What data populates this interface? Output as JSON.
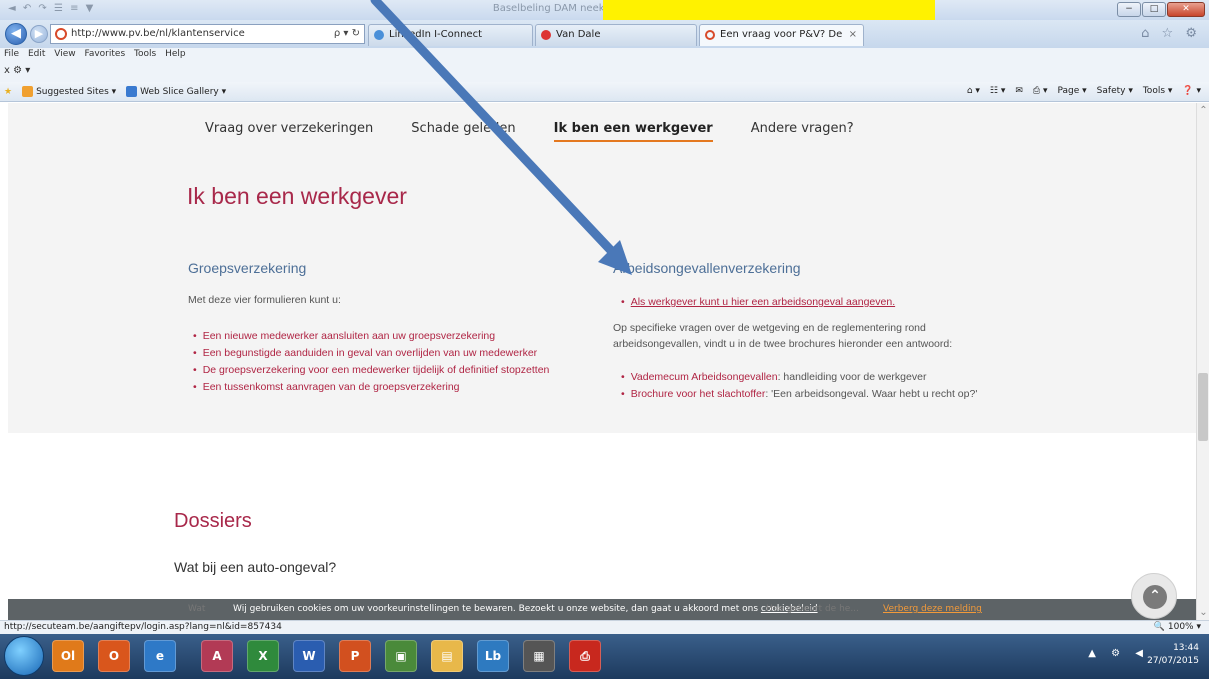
{
  "window": {
    "title": "Baselbeling DAM neek doco - Microsoft Word",
    "quick_access": "◄ ↶ ↷ ☰ ≡ ▼",
    "controls": {
      "minimize": "−",
      "maximize": "□",
      "close": "✕"
    }
  },
  "address": {
    "url": "http://www.pv.be/nl/klantenservice",
    "tools": "ρ ▾ ↻"
  },
  "tabs": [
    {
      "label": "LinkedIn I-Connect",
      "color": "#4a90d9"
    },
    {
      "label": "Van Dale",
      "color": "#d33"
    },
    {
      "label": "Een vraag voor P&V? De kla...",
      "color": "#d84a2a",
      "active": true
    }
  ],
  "chrome_icons": "⌂ ☆ ⚙",
  "menu": [
    "File",
    "Edit",
    "View",
    "Favorites",
    "Tools",
    "Help"
  ],
  "command_bar": "x  ⚙ ▾",
  "favorites": {
    "items": [
      {
        "label": "Suggested Sites ▾",
        "color": "#f0a030"
      },
      {
        "label": "Web Slice Gallery ▾",
        "color": "#3a7ad0"
      }
    ],
    "right_tools": [
      "⌂ ▾",
      "☷ ▾",
      "✉",
      "⎙ ▾",
      "Page ▾",
      "Safety ▾",
      "Tools ▾",
      "❓ ▾"
    ]
  },
  "page": {
    "nav": [
      "Vraag over verzekeringen",
      "Schade geleden",
      "Ik ben een werkgever",
      "Andere vragen?"
    ],
    "heading": "Ik ben een werkgever",
    "left": {
      "title": "Groepsverzekering",
      "intro": "Met deze vier formulieren kunt u:",
      "links": [
        "Een nieuwe medewerker aansluiten aan uw groepsverzekering",
        "Een begunstigde aanduiden in geval van overlijden van uw medewerker",
        "De groepsverzekering voor een medewerker tijdelijk of definitief stopzetten",
        "Een tussenkomst aanvragen van de groepsverzekering"
      ]
    },
    "right": {
      "title": "Arbeidsongevallenverzekering",
      "declare_link": "Als werkgever kunt u hier een arbeidsongeval aangeven.",
      "text": "Op specifieke vragen over de wetgeving en de reglementering rond arbeidsongevallen, vindt u in de twee brochures hieronder een antwoord:",
      "brochures": [
        {
          "link": "Vademecum Arbeidsongevallen",
          "rest": ": handleiding voor de werkgever"
        },
        {
          "link": "Brochure voor het slachtoffer",
          "rest": ": 'Een arbeidsongeval. Waar hebt u recht op?'"
        }
      ]
    },
    "dossiers_heading": "Dossiers",
    "dossiers_sub": "Wat bij een auto-ongeval?",
    "cookie": {
      "text": "Wij gebruiken cookies om uw voorkeurinstellingen te bewaren. Bezoekt u onze website, dan gaat u akkoord met ons ",
      "link": "cookiebeleid",
      "hide": "Verberg deze melding",
      "ghost_left": "Wat",
      "ghost_right": "Hoe gebeurt de he..."
    }
  },
  "status": {
    "url": "http://secuteam.be/aangiftepv/login.asp?lang=nl&id=857434",
    "zoom": "🔍 100%  ▾"
  },
  "taskbar": {
    "icons": [
      "Ol",
      "O",
      "e",
      "A",
      "X",
      "W",
      "P",
      "▣",
      "▤",
      "Lb",
      "▦",
      "⎙"
    ],
    "time": "13:44",
    "date": "27/07/2015",
    "tray": "▲ ⚙ ◀"
  },
  "overlay": {
    "highlight_color": "#fff200",
    "arrow_color": "#4a78b8"
  }
}
